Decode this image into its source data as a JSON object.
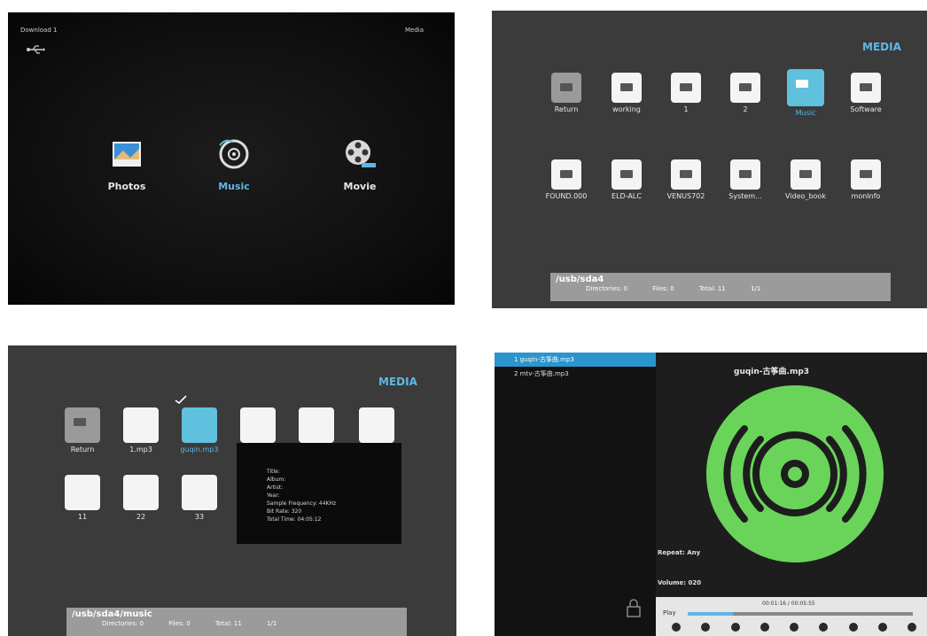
{
  "home_screen": {
    "top_left": "Download 1",
    "top_right": "Media",
    "items": [
      {
        "label": "Photos",
        "icon": "photos-icon"
      },
      {
        "label": "Music",
        "icon": "music-icon",
        "active": true
      },
      {
        "label": "Movie",
        "icon": "movie-icon"
      }
    ]
  },
  "folder_browser": {
    "title": "MEDIA",
    "row1": [
      "Return",
      "working",
      "1",
      "2",
      "Music",
      "Software"
    ],
    "row2": [
      "FOUND.000",
      "ELD-ALC",
      "VENUS702",
      "System...",
      "Video_book",
      "monInfo"
    ],
    "path": "/usb/sda4",
    "counts": [
      "Directories: 0",
      "Files: 0",
      "Total: 11",
      "1/1"
    ]
  },
  "music_browser": {
    "title": "MEDIA",
    "row1": [
      "Return",
      "1.mp3",
      "guqin.mp3",
      "",
      "",
      ""
    ],
    "row2": [
      "11",
      "22",
      "33"
    ],
    "info_lines": [
      "Title:",
      "Album:",
      "Artist:",
      "Year:",
      "Sample Frequency: 44KHz",
      "Bit Rate: 320",
      "Total Time: 04:05:12"
    ],
    "path": "/usb/sda4/music",
    "counts": [
      "Directories: 0",
      "Files: 0",
      "Total: 11",
      "1/1"
    ]
  },
  "player": {
    "playlist": [
      "1 guqin-古筝曲.mp3",
      "2 mtv-古筝曲.mp3"
    ],
    "now_playing": "guqin-古筝曲.mp3",
    "repeat": "Repeat: Any",
    "volume": "Volume: 020",
    "time": "00:01:16 / 00:05:55",
    "state": "Play",
    "progress": 0.2,
    "controls": [
      "prev",
      "rewind",
      "play",
      "pause",
      "stop",
      "forward",
      "next",
      "repeat",
      "info"
    ]
  },
  "colors": {
    "accent": "#5fb7e6",
    "disc": "#6ad45a",
    "panel": "#3b3b3b"
  }
}
